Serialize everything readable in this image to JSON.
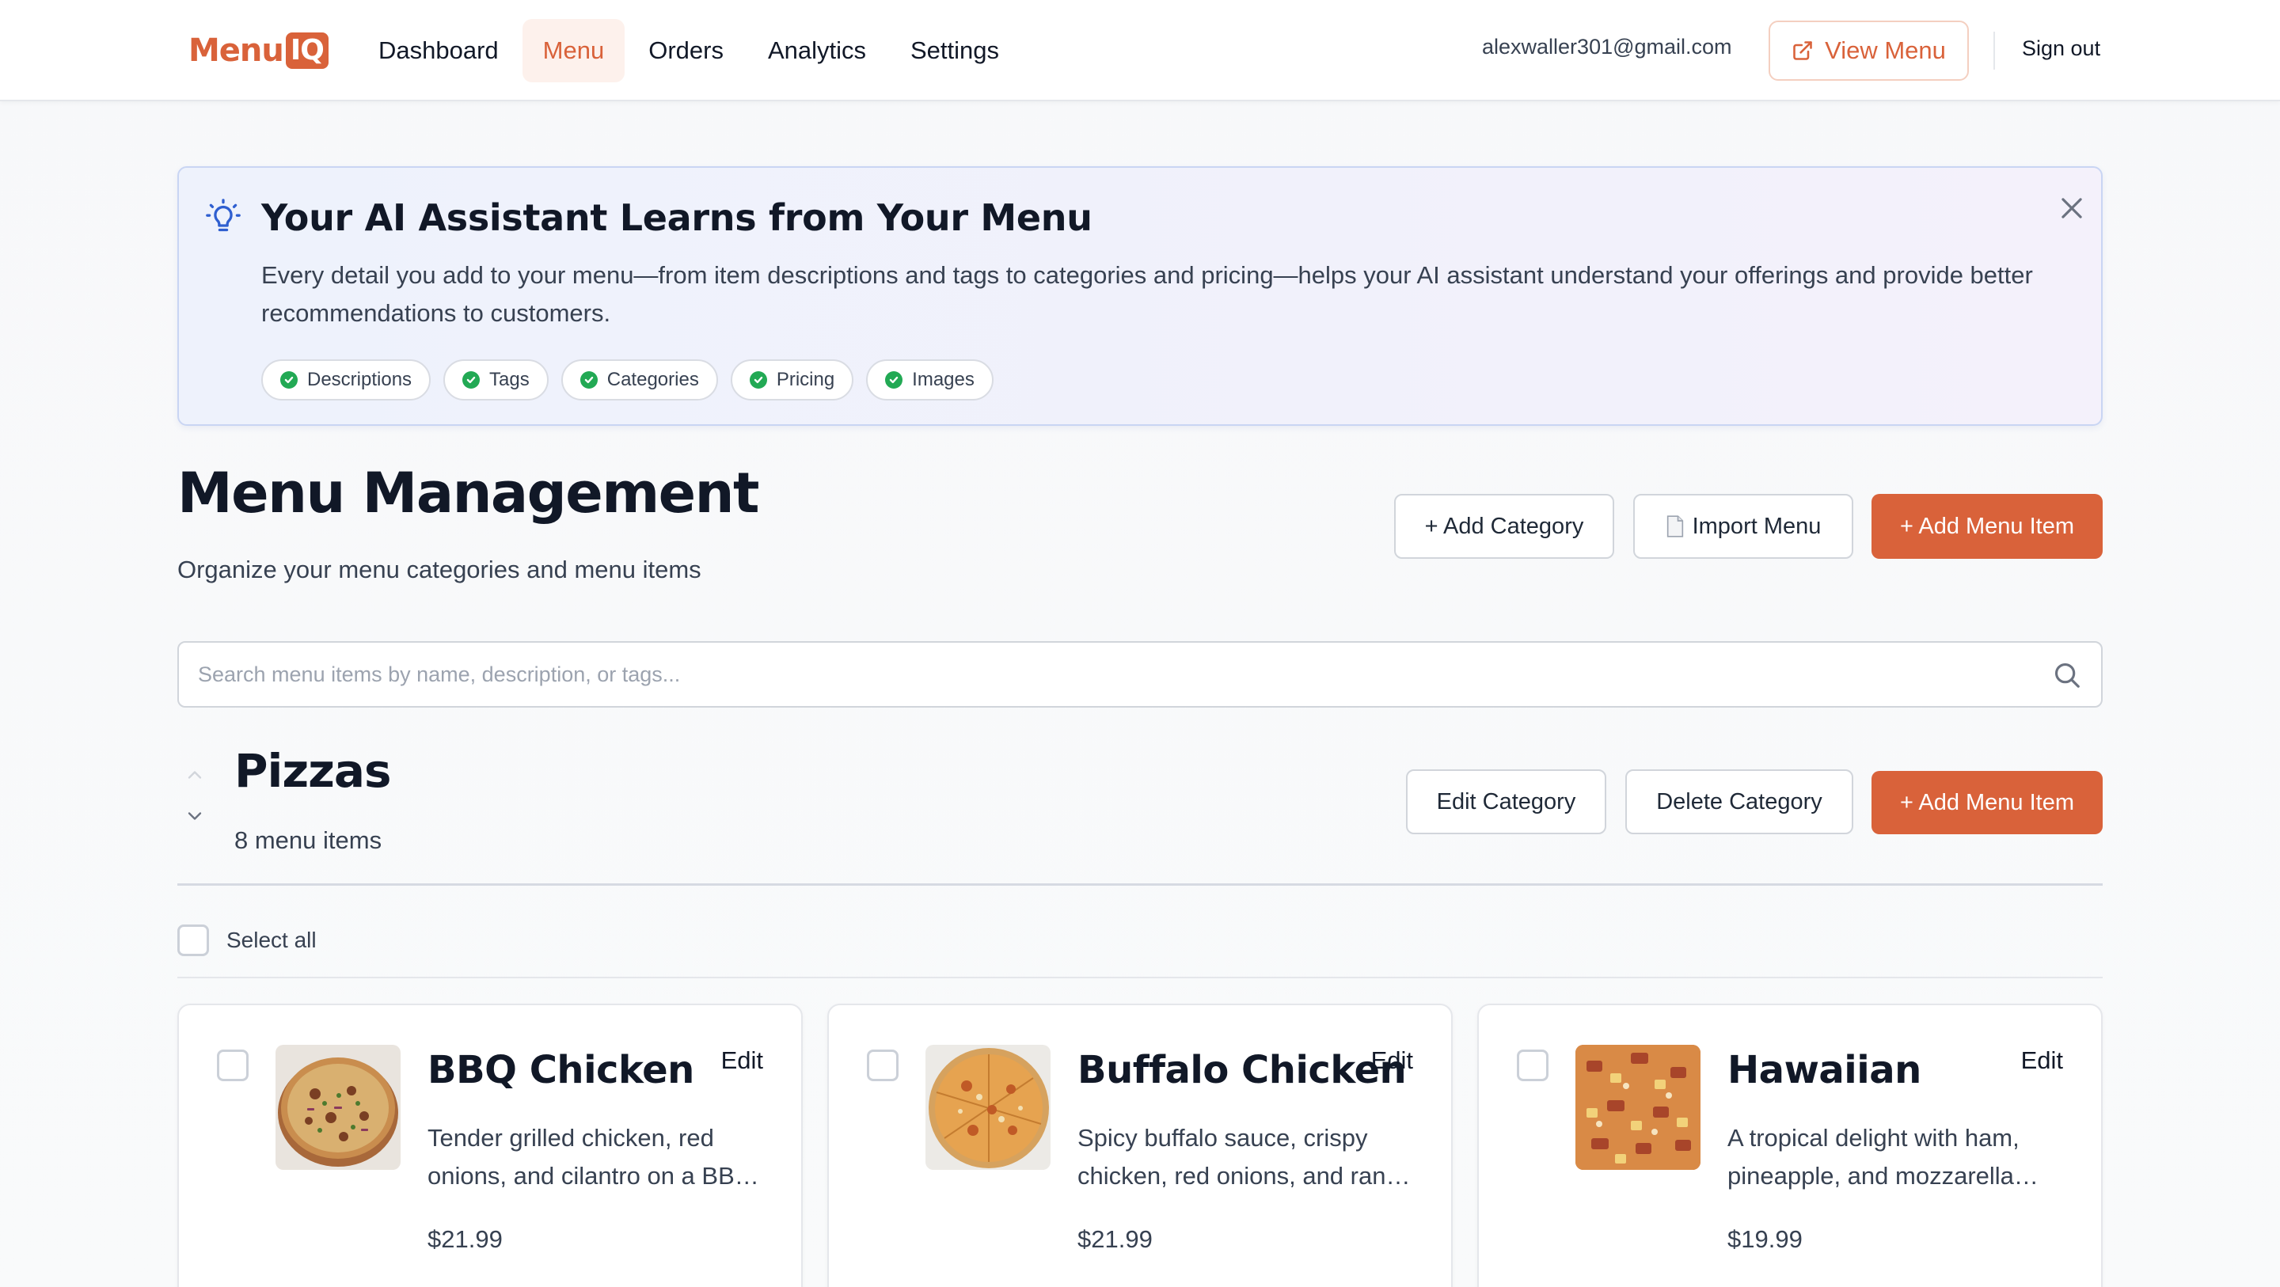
{
  "nav": {
    "logo_text": "Menu",
    "logo_badge": "IQ",
    "links": [
      {
        "label": "Dashboard",
        "active": false
      },
      {
        "label": "Menu",
        "active": true
      },
      {
        "label": "Orders",
        "active": false
      },
      {
        "label": "Analytics",
        "active": false
      },
      {
        "label": "Settings",
        "active": false
      }
    ],
    "user_email": "alexwaller301@gmail.com",
    "view_menu_label": "View Menu",
    "view_menu_icon": "external-link-icon",
    "sign_out_label": "Sign out"
  },
  "banner": {
    "icon": "lightbulb-icon",
    "title": "Your AI Assistant Learns from Your Menu",
    "text": "Every detail you add to your menu—from item descriptions and tags to categories and pricing—helps your AI assistant understand your offerings and provide better recommendations to customers.",
    "chips": [
      "Descriptions",
      "Tags",
      "Categories",
      "Pricing",
      "Images"
    ],
    "close_icon": "close-icon"
  },
  "header": {
    "title": "Menu Management",
    "subtitle": "Organize your menu categories and menu items",
    "add_category_label": "+ Add Category",
    "import_menu_label": "Import Menu",
    "import_menu_icon": "document-icon",
    "add_menu_item_label": "+ Add Menu Item"
  },
  "search": {
    "placeholder": "Search menu items by name, description, or tags...",
    "value": ""
  },
  "category": {
    "name": "Pizzas",
    "count_label": "8 menu items",
    "edit_label": "Edit Category",
    "delete_label": "Delete Category",
    "add_item_label": "+ Add Menu Item",
    "select_all_label": "Select all"
  },
  "items": [
    {
      "name": "BBQ Chicken",
      "description": "Tender grilled chicken, red onions, and cilantro on a BBQ sauce base",
      "price": "$21.99",
      "edit_label": "Edit"
    },
    {
      "name": "Buffalo Chicken",
      "description": "Spicy buffalo sauce, crispy chicken, red onions, and ranch drizzle",
      "price": "$21.99",
      "edit_label": "Edit"
    },
    {
      "name": "Hawaiian",
      "description": "A tropical delight with ham, pineapple, and mozzarella cheese",
      "price": "$19.99",
      "edit_label": "Edit"
    }
  ],
  "colors": {
    "brand": "#d9623a",
    "banner_border": "#c9d5f3",
    "check_green": "#22a954"
  }
}
